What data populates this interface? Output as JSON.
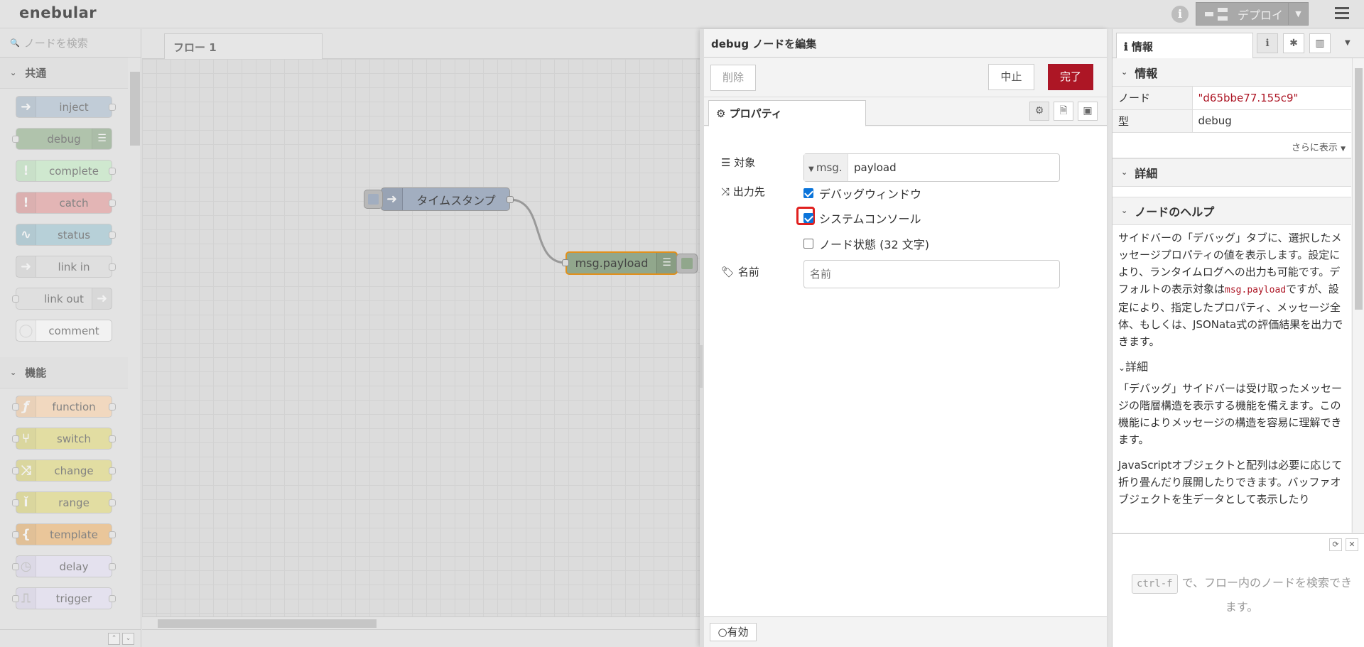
{
  "header": {
    "logo": "enebular",
    "deploy_label": "デプロイ"
  },
  "palette": {
    "search_placeholder": "ノードを検索",
    "categories": [
      {
        "label": "共通",
        "nodes": [
          {
            "label": "inject",
            "color": "#a6bbcf"
          },
          {
            "label": "debug",
            "color": "#87a980"
          },
          {
            "label": "complete",
            "color": "#c0edc0"
          },
          {
            "label": "catch",
            "color": "#e49191"
          },
          {
            "label": "status",
            "color": "#94c1d0"
          },
          {
            "label": "link in",
            "color": "#dddddd"
          },
          {
            "label": "link out",
            "color": "#dddddd"
          },
          {
            "label": "comment",
            "color": "#ffffff"
          }
        ]
      },
      {
        "label": "機能",
        "nodes": [
          {
            "label": "function",
            "color": "#fdd0a2"
          },
          {
            "label": "switch",
            "color": "#e2d96e"
          },
          {
            "label": "change",
            "color": "#e2d96e"
          },
          {
            "label": "range",
            "color": "#e2d96e"
          },
          {
            "label": "template",
            "color": "#f0b060"
          },
          {
            "label": "delay",
            "color": "#e6e0f8"
          },
          {
            "label": "trigger",
            "color": "#e6e0f8"
          }
        ]
      }
    ]
  },
  "workspace": {
    "tab_label": "フロー 1",
    "nodes": {
      "inject_label": "タイムスタンプ",
      "debug_label": "msg.payload"
    }
  },
  "tray": {
    "title": "debug ノードを編集",
    "delete_label": "削除",
    "cancel_label": "中止",
    "done_label": "完了",
    "tab_label": "プロパティ",
    "target_label": "対象",
    "target_prefix": "msg.",
    "target_value": "payload",
    "output_label": "出力先",
    "options": [
      {
        "label": "デバッグウィンドウ",
        "checked": true
      },
      {
        "label": "システムコンソール",
        "checked": true
      },
      {
        "label": "ノード状態 (32 文字)",
        "checked": false
      }
    ],
    "name_label": "名前",
    "name_placeholder": "名前",
    "enabled_label": "有効"
  },
  "sidebar": {
    "tab_label": "情報",
    "info_section": "情報",
    "node_key": "ノード",
    "node_value": "\"d65bbe77.155c9\"",
    "type_key": "型",
    "type_value": "debug",
    "more_label": "さらに表示",
    "details_section": "詳細",
    "help_section": "ノードのヘルプ",
    "help_p1_a": "サイドバーの「デバッグ」タブに、選択したメッセージプロパティの値を表示します。設定により、ランタイムログへの出力も可能です。デフォルトの表示対象は",
    "help_p1_code": "msg.payload",
    "help_p1_b": "ですが、設定により、指定したプロパティ、メッセージ全体、もしくは、JSONata式の評価結果を出力できます。",
    "help_sub": "詳細",
    "help_p2": "「デバッグ」サイドバーは受け取ったメッセージの階層構造を表示する機能を備えます。この機能によりメッセージの構造を容易に理解できます。",
    "help_p3": "JavaScriptオブジェクトと配列は必要に応じて折り畳んだり展開したりできます。バッファオブジェクトを生データとして表示したり",
    "search_kbd": "ctrl-f",
    "search_hint": "で、フロー内のノードを検索できます。"
  }
}
